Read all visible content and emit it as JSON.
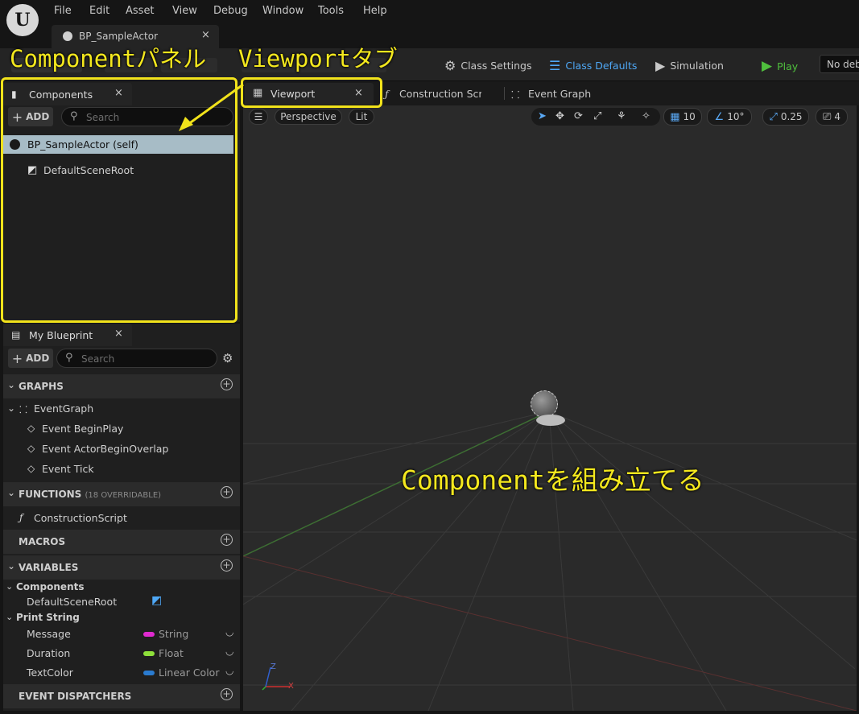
{
  "menu": {
    "logo": "U",
    "items": [
      "File",
      "Edit",
      "Asset",
      "View",
      "Debug",
      "Window",
      "Tools",
      "Help"
    ]
  },
  "document_tab": {
    "title": "BP_SampleActor",
    "close": "×"
  },
  "toolbar": {
    "class_settings": "Class Settings",
    "class_defaults": "Class Defaults",
    "simulation": "Simulation",
    "play": "Play",
    "debug_object": "No debug"
  },
  "components_panel": {
    "tab_label": "Components",
    "close": "×",
    "add_label": "ADD",
    "search_placeholder": "Search",
    "items": [
      {
        "label": "BP_SampleActor (self)"
      },
      {
        "label": "DefaultSceneRoot"
      }
    ]
  },
  "my_blueprint": {
    "tab_label": "My Blueprint",
    "close": "×",
    "add_label": "ADD",
    "search_placeholder": "Search",
    "graphs": {
      "title": "GRAPHS",
      "graph": "EventGraph",
      "events": [
        "Event BeginPlay",
        "Event ActorBeginOverlap",
        "Event Tick"
      ]
    },
    "functions": {
      "title": "FUNCTIONS",
      "overridable": "(18 OVERRIDABLE)",
      "items": [
        "ConstructionScript"
      ]
    },
    "macros": {
      "title": "MACROS"
    },
    "variables": {
      "title": "VARIABLES",
      "groups": [
        {
          "name": "Components",
          "vars": [
            {
              "name": "DefaultSceneRoot"
            }
          ]
        },
        {
          "name": "Print String",
          "vars": [
            {
              "name": "Message",
              "type": "String",
              "color": "#e02ad0"
            },
            {
              "name": "Duration",
              "type": "Float",
              "color": "#8ee03a"
            },
            {
              "name": "TextColor",
              "type": "Linear Color",
              "color": "#2a7bd0"
            }
          ]
        }
      ]
    },
    "dispatchers": {
      "title": "EVENT DISPATCHERS"
    }
  },
  "editor_tabs": {
    "viewport": "Viewport",
    "close": "×",
    "construction": "Construction Scrip",
    "event_graph": "Event Graph"
  },
  "viewport": {
    "perspective": "Perspective",
    "lit": "Lit",
    "grid_snap": "10",
    "rotation_snap": "10°",
    "scale_snap": "0.25",
    "camera_speed": "4",
    "axis_z": "Z",
    "axis_x": "X"
  },
  "annotations": {
    "component_panel": "Componentパネル",
    "viewport_tab": "Viewportタブ",
    "assemble": "Componentを組み立てる"
  },
  "colors": {
    "accent_blue": "#4ea7f5",
    "play_green": "#4fbf3d",
    "annotation_yellow": "#f2e31b",
    "selection": "#a7bcc6"
  }
}
